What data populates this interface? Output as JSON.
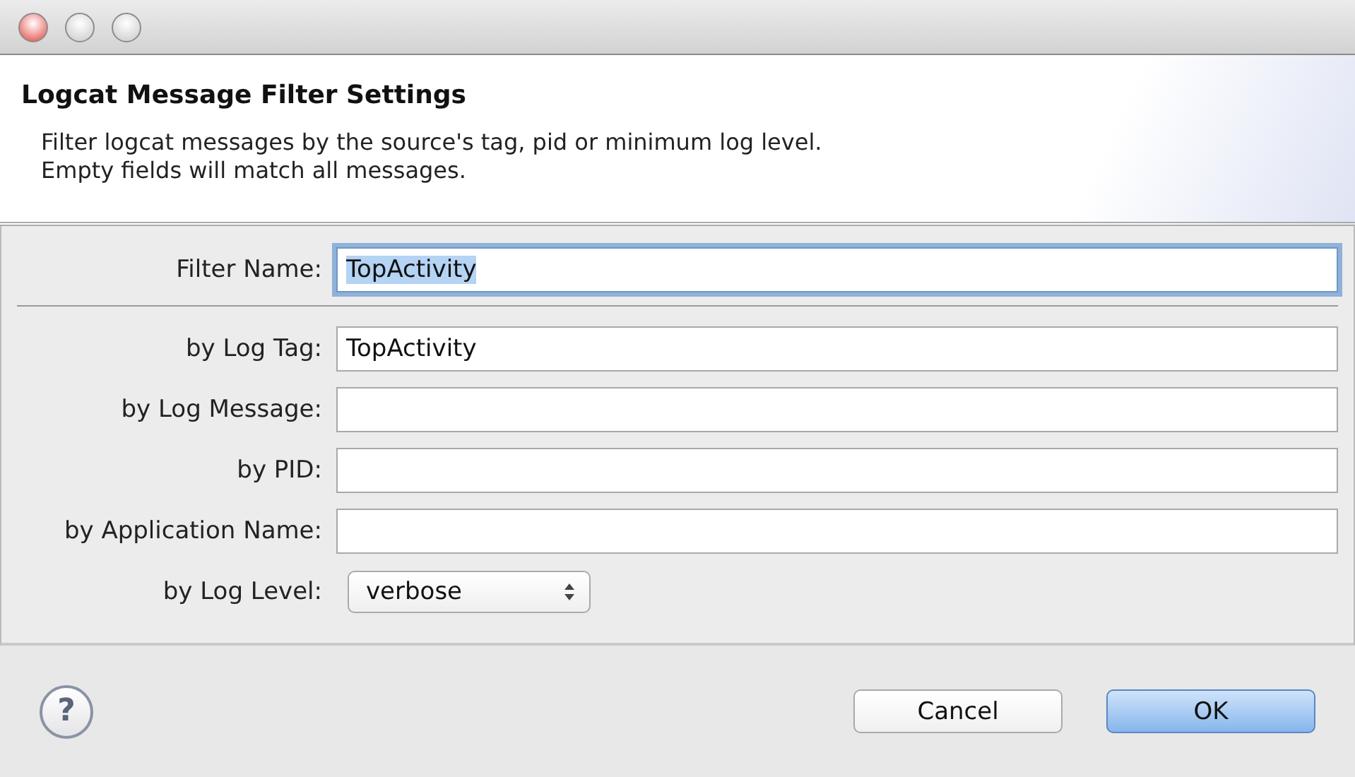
{
  "dialog": {
    "title": "Logcat Message Filter Settings",
    "description": [
      "Filter logcat messages by the source's tag, pid or minimum log level.",
      "Empty fields will match all messages."
    ]
  },
  "name_field": {
    "label": "Filter Name:",
    "value": "TopActivity",
    "focused": true,
    "text_selected": true
  },
  "fields": [
    {
      "kind": "text",
      "label": "by Log Tag:",
      "value": "TopActivity"
    },
    {
      "kind": "text",
      "label": "by Log Message:"
    },
    {
      "kind": "text",
      "label": "by PID:"
    },
    {
      "kind": "text",
      "label": "by Application Name:"
    },
    {
      "kind": "select",
      "label": "by Log Level:",
      "value": "verbose"
    }
  ],
  "help": "?",
  "buttons": [
    {
      "label": "Cancel",
      "default": false
    },
    {
      "label": "OK",
      "default": true
    }
  ]
}
